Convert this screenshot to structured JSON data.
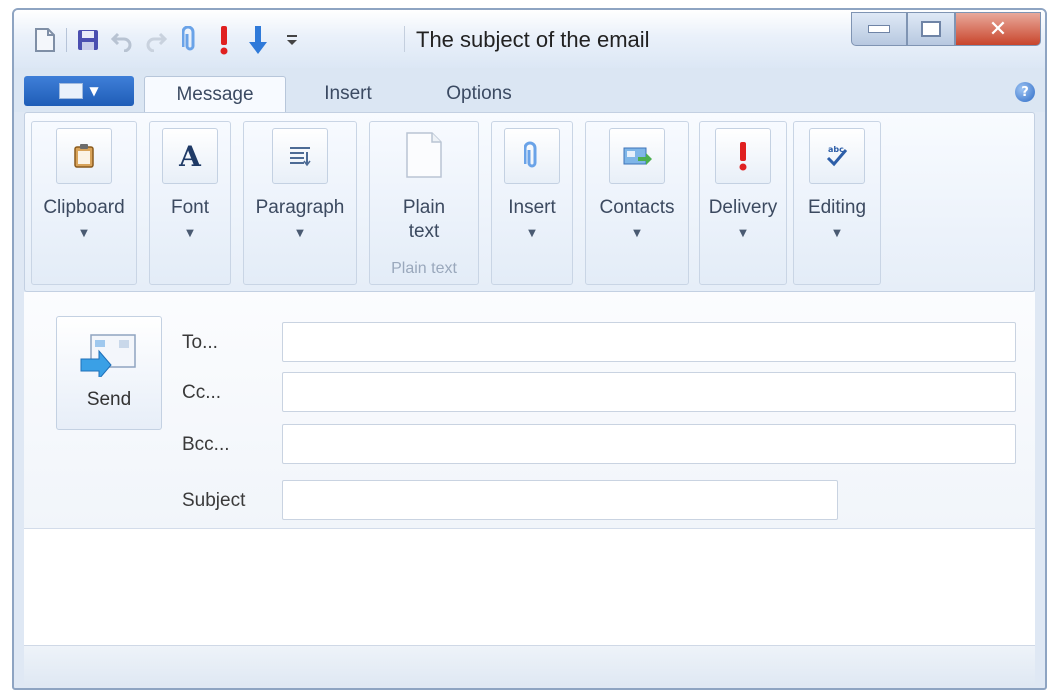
{
  "window": {
    "title": "The subject of the email"
  },
  "quick_access": {
    "icons": [
      "new-icon",
      "save-icon",
      "undo-icon",
      "redo-icon",
      "attach-icon",
      "high-importance-icon",
      "low-importance-icon",
      "customize-dropdown-icon"
    ]
  },
  "tabs": [
    {
      "label": "Message",
      "active": true
    },
    {
      "label": "Insert",
      "active": false
    },
    {
      "label": "Options",
      "active": false
    }
  ],
  "ribbon": {
    "groups": [
      {
        "label": "Clipboard",
        "icon": "clipboard-icon"
      },
      {
        "label": "Font",
        "icon": "font-icon"
      },
      {
        "label": "Paragraph",
        "icon": "paragraph-icon"
      },
      {
        "label": "Plain\ntext",
        "icon": "plain-text-icon",
        "group_label": "Plain text"
      },
      {
        "label": "Insert",
        "icon": "paperclip-icon"
      },
      {
        "label": "Contacts",
        "icon": "contacts-icon"
      },
      {
        "label": "Delivery",
        "icon": "exclamation-icon"
      },
      {
        "label": "Editing",
        "icon": "spellcheck-icon"
      }
    ]
  },
  "compose": {
    "send_label": "Send",
    "to_label": "To...",
    "cc_label": "Cc...",
    "bcc_label": "Bcc...",
    "subject_label": "Subject",
    "to_value": "",
    "cc_value": "",
    "bcc_value": "",
    "subject_value": ""
  },
  "colors": {
    "accent": "#1f5db7",
    "close_button": "#c8452c",
    "importance_red": "#e02020",
    "arrow_blue": "#2f7ad9"
  }
}
